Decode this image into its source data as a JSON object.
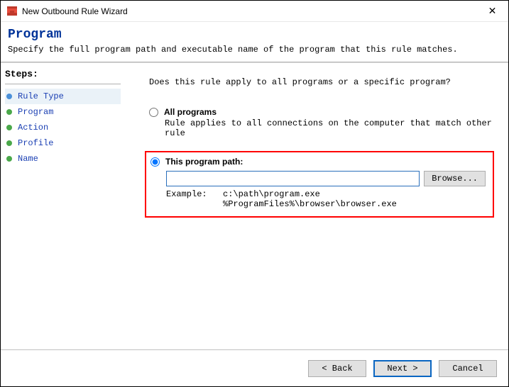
{
  "window": {
    "title": "New Outbound Rule Wizard"
  },
  "header": {
    "title": "Program",
    "subtitle": "Specify the full program path and executable name of the program that this rule matches."
  },
  "steps": {
    "title": "Steps:",
    "items": [
      {
        "label": "Rule Type"
      },
      {
        "label": "Program"
      },
      {
        "label": "Action"
      },
      {
        "label": "Profile"
      },
      {
        "label": "Name"
      }
    ]
  },
  "content": {
    "question": "Does this rule apply to all programs or a specific program?",
    "option_all": {
      "label": "All programs",
      "desc": "Rule applies to all connections on the computer that match other rule"
    },
    "option_path": {
      "label": "This program path:",
      "value": "",
      "browse": "Browse...",
      "example_label": "Example:",
      "example1": "c:\\path\\program.exe",
      "example2": "%ProgramFiles%\\browser\\browser.exe"
    }
  },
  "footer": {
    "back": "< Back",
    "next": "Next >",
    "cancel": "Cancel"
  }
}
